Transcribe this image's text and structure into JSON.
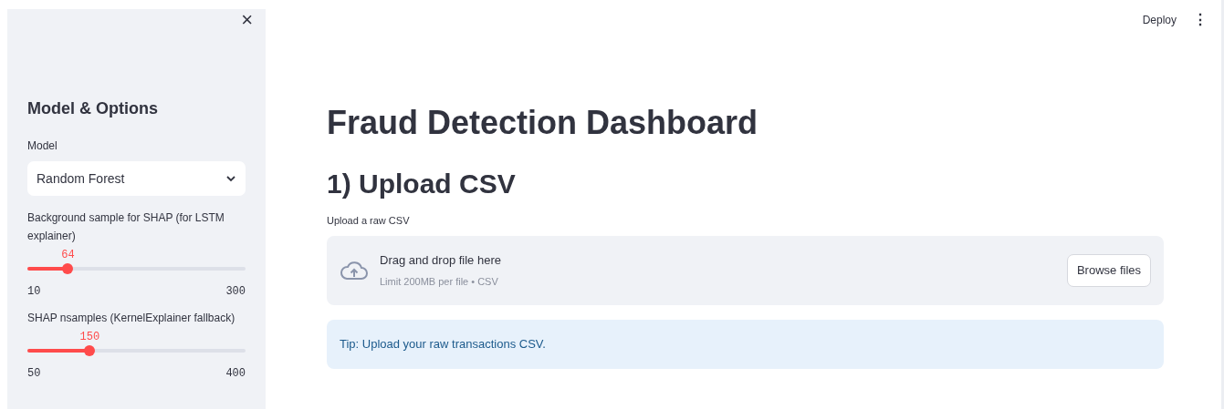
{
  "header": {
    "deploy": "Deploy",
    "menu": "⋮"
  },
  "sidebar": {
    "close": "×",
    "title": "Model & Options",
    "select": {
      "label": "Model",
      "value": "Random Forest"
    },
    "sliders": [
      {
        "label": "Background sample for SHAP (for LSTM explainer)",
        "value": "64",
        "level": 0.186,
        "min": "10",
        "max": "300"
      },
      {
        "label": "SHAP nsamples (KernelExplainer fallback)",
        "value": "150",
        "level": 0.286,
        "min": "50",
        "max": "400"
      }
    ]
  },
  "main": {
    "title": "Fraud Detection Dashboard",
    "section": "1) Upload CSV",
    "uploader": {
      "label": "Upload a raw CSV",
      "prompt": "Drag and drop file here",
      "limit": "Limit 200MB per file • CSV",
      "button": "Browse files"
    },
    "info": "Tip: Upload your raw transactions CSV."
  }
}
